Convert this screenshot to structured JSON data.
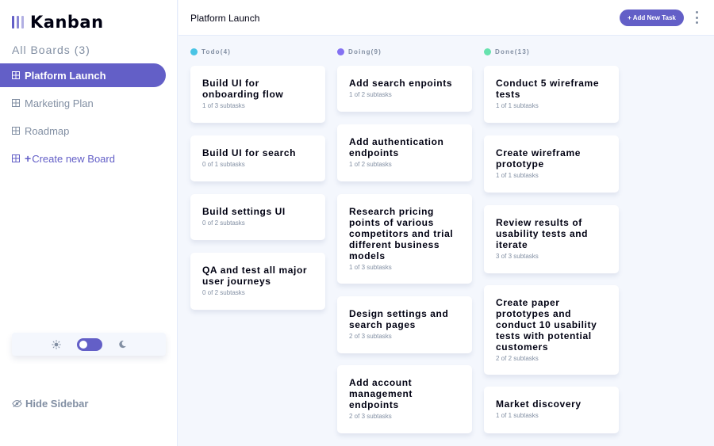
{
  "app": {
    "logo_text": "Kanban"
  },
  "sidebar": {
    "heading": "All Boards (3)",
    "boards": [
      {
        "label": "Platform Launch",
        "active": true
      },
      {
        "label": "Marketing Plan",
        "active": false
      },
      {
        "label": "Roadmap",
        "active": false
      }
    ],
    "create_label": "Create new Board",
    "hide_label": "Hide Sidebar"
  },
  "theme": {
    "light_icon": "sun-icon",
    "dark_icon": "moon-icon",
    "mode": "light"
  },
  "header": {
    "title": "Platform Launch",
    "add_task_label": "+ Add New Task"
  },
  "colors": {
    "accent": "#635fc7",
    "todo": "#49c4e5",
    "doing": "#8471f2",
    "done": "#67e2ae",
    "muted": "#828fa3",
    "bg": "#f4f7fd"
  },
  "columns": [
    {
      "name": "Todo(4)",
      "cards": [
        {
          "title": "Build UI for onboarding flow",
          "subtasks": "1 of 3 subtasks"
        },
        {
          "title": "Build UI for search",
          "subtasks": "0 of 1 subtasks"
        },
        {
          "title": "Build settings UI",
          "subtasks": "0 of 2 subtasks"
        },
        {
          "title": "QA and test all major user journeys",
          "subtasks": "0 of 2 subtasks"
        }
      ]
    },
    {
      "name": "Doing(9)",
      "cards": [
        {
          "title": "Add search enpoints",
          "subtasks": "1 of 2 subtasks"
        },
        {
          "title": "Add authentication endpoints",
          "subtasks": "1 of 2 subtasks"
        },
        {
          "title": "Research pricing points of various competitors and trial different business models",
          "subtasks": "1 of 3 subtasks"
        },
        {
          "title": "Design settings and search pages",
          "subtasks": "2 of 3 subtasks"
        },
        {
          "title": "Add account management endpoints",
          "subtasks": "2 of 3 subtasks"
        }
      ]
    },
    {
      "name": "Done(13)",
      "cards": [
        {
          "title": "Conduct 5 wireframe tests",
          "subtasks": "1 of 1 subtasks"
        },
        {
          "title": "Create wireframe prototype",
          "subtasks": "1 of 1 subtasks"
        },
        {
          "title": "Review results of usability tests and iterate",
          "subtasks": "3 of 3 subtasks"
        },
        {
          "title": "Create paper prototypes and conduct 10 usability tests with potential customers",
          "subtasks": "2 of 2 subtasks"
        },
        {
          "title": "Market discovery",
          "subtasks": "1 of 1 subtasks"
        }
      ]
    }
  ]
}
